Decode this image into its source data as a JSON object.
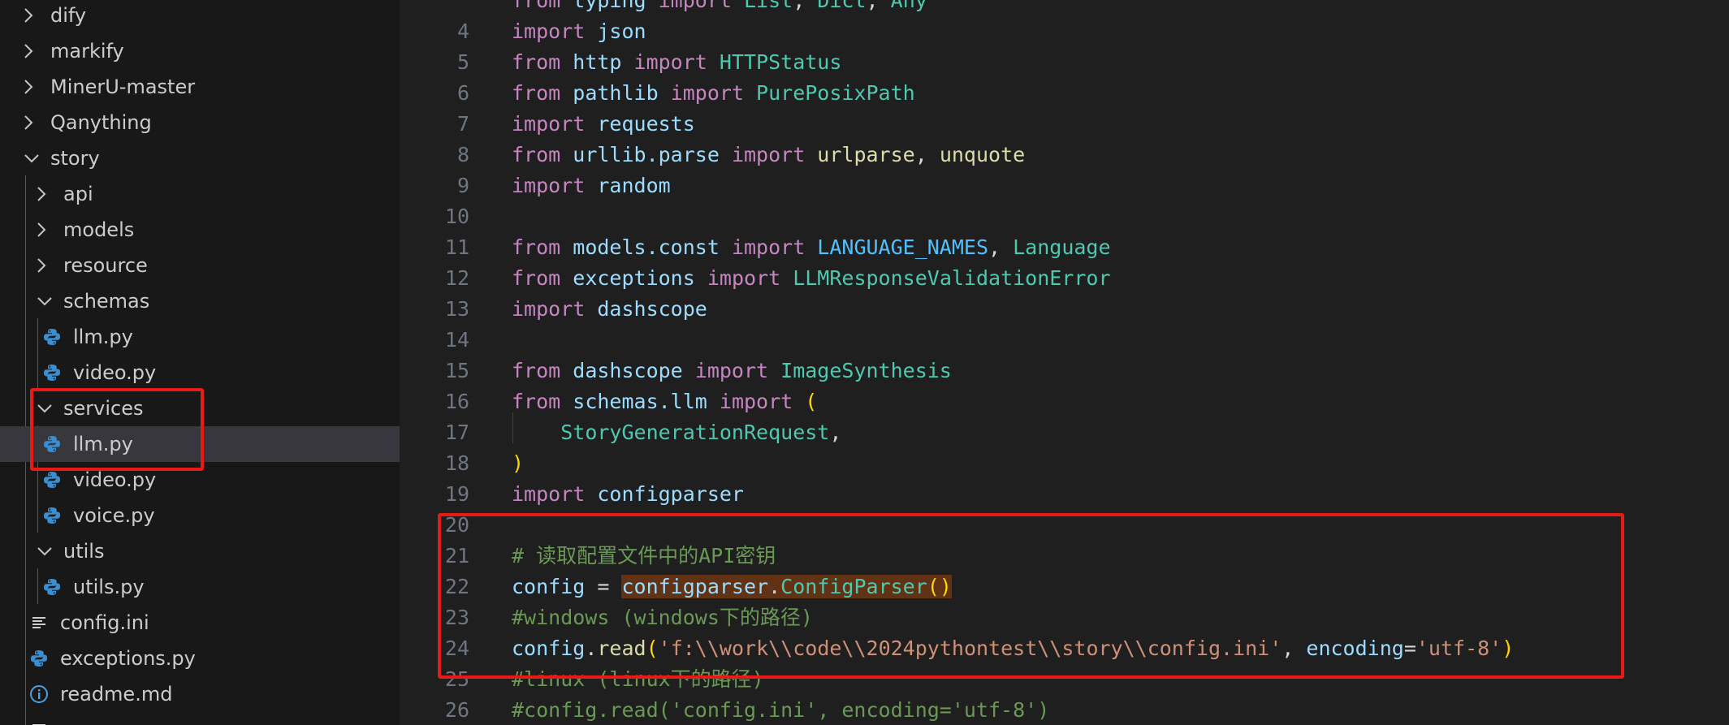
{
  "explorer": {
    "items": [
      {
        "label": "dify",
        "indent": 0,
        "kind": "folder",
        "open": false
      },
      {
        "label": "markify",
        "indent": 0,
        "kind": "folder",
        "open": false
      },
      {
        "label": "MinerU-master",
        "indent": 0,
        "kind": "folder",
        "open": false
      },
      {
        "label": "Qanything",
        "indent": 0,
        "kind": "folder",
        "open": false
      },
      {
        "label": "story",
        "indent": 0,
        "kind": "folder",
        "open": true
      },
      {
        "label": "api",
        "indent": 1,
        "kind": "folder",
        "open": false
      },
      {
        "label": "models",
        "indent": 1,
        "kind": "folder",
        "open": false
      },
      {
        "label": "resource",
        "indent": 1,
        "kind": "folder",
        "open": false
      },
      {
        "label": "schemas",
        "indent": 1,
        "kind": "folder",
        "open": true
      },
      {
        "label": "llm.py",
        "indent": 2,
        "kind": "python"
      },
      {
        "label": "video.py",
        "indent": 2,
        "kind": "python"
      },
      {
        "label": "services",
        "indent": 1,
        "kind": "folder",
        "open": true
      },
      {
        "label": "llm.py",
        "indent": 2,
        "kind": "python",
        "selected": true
      },
      {
        "label": "video.py",
        "indent": 2,
        "kind": "python"
      },
      {
        "label": "voice.py",
        "indent": 2,
        "kind": "python"
      },
      {
        "label": "utils",
        "indent": 1,
        "kind": "folder",
        "open": true
      },
      {
        "label": "utils.py",
        "indent": 2,
        "kind": "python"
      },
      {
        "label": "config.ini",
        "indent": 1,
        "kind": "ini"
      },
      {
        "label": "exceptions.py",
        "indent": 1,
        "kind": "python"
      },
      {
        "label": "readme.md",
        "indent": 1,
        "kind": "info"
      },
      {
        "label": "",
        "indent": 1,
        "kind": "ini"
      }
    ]
  },
  "editor": {
    "lines": [
      {
        "n": "",
        "tokens": [
          [
            "k",
            "from "
          ],
          [
            "d",
            "typing "
          ],
          [
            "k",
            "import "
          ],
          [
            "t",
            "List"
          ],
          [
            "p",
            ", "
          ],
          [
            "t",
            "Dict"
          ],
          [
            "p",
            ", "
          ],
          [
            "t",
            "Any"
          ]
        ]
      },
      {
        "n": "4",
        "tokens": [
          [
            "k",
            "import "
          ],
          [
            "d",
            "json"
          ]
        ]
      },
      {
        "n": "5",
        "tokens": [
          [
            "k",
            "from "
          ],
          [
            "d",
            "http "
          ],
          [
            "k",
            "import "
          ],
          [
            "t",
            "HTTPStatus"
          ]
        ]
      },
      {
        "n": "6",
        "tokens": [
          [
            "k",
            "from "
          ],
          [
            "d",
            "pathlib "
          ],
          [
            "k",
            "import "
          ],
          [
            "t",
            "PurePosixPath"
          ]
        ]
      },
      {
        "n": "7",
        "tokens": [
          [
            "k",
            "import "
          ],
          [
            "d",
            "requests"
          ]
        ]
      },
      {
        "n": "8",
        "tokens": [
          [
            "k",
            "from "
          ],
          [
            "d",
            "urllib.parse "
          ],
          [
            "k",
            "import "
          ],
          [
            "f",
            "urlparse"
          ],
          [
            "p",
            ", "
          ],
          [
            "f",
            "unquote"
          ]
        ]
      },
      {
        "n": "9",
        "tokens": [
          [
            "k",
            "import "
          ],
          [
            "d",
            "random"
          ]
        ]
      },
      {
        "n": "10",
        "tokens": []
      },
      {
        "n": "11",
        "tokens": [
          [
            "k",
            "from "
          ],
          [
            "d",
            "models.const "
          ],
          [
            "k",
            "import "
          ],
          [
            "v",
            "LANGUAGE_NAMES"
          ],
          [
            "p",
            ", "
          ],
          [
            "t",
            "Language"
          ]
        ]
      },
      {
        "n": "12",
        "tokens": [
          [
            "k",
            "from "
          ],
          [
            "d",
            "exceptions "
          ],
          [
            "k",
            "import "
          ],
          [
            "t",
            "LLMResponseValidationError"
          ]
        ]
      },
      {
        "n": "13",
        "tokens": [
          [
            "k",
            "import "
          ],
          [
            "d",
            "dashscope"
          ]
        ]
      },
      {
        "n": "14",
        "tokens": []
      },
      {
        "n": "15",
        "tokens": [
          [
            "k",
            "from "
          ],
          [
            "d",
            "dashscope "
          ],
          [
            "k",
            "import "
          ],
          [
            "t",
            "ImageSynthesis"
          ]
        ]
      },
      {
        "n": "16",
        "tokens": [
          [
            "k",
            "from "
          ],
          [
            "d",
            "schemas.llm "
          ],
          [
            "k",
            "import "
          ],
          [
            "y",
            "("
          ]
        ]
      },
      {
        "n": "17",
        "tokens": [
          [
            "p",
            "    "
          ],
          [
            "t",
            "StoryGenerationRequest"
          ],
          [
            "p",
            ","
          ]
        ]
      },
      {
        "n": "18",
        "tokens": [
          [
            "y",
            ")"
          ]
        ]
      },
      {
        "n": "19",
        "tokens": [
          [
            "k",
            "import "
          ],
          [
            "d",
            "configparser"
          ]
        ]
      },
      {
        "n": "20",
        "tokens": []
      },
      {
        "n": "21",
        "tokens": [
          [
            "c",
            "# 读取配置文件中的API密钥"
          ]
        ]
      },
      {
        "n": "22",
        "tokens": [
          [
            "d",
            "config "
          ],
          [
            "p",
            "= "
          ],
          [
            "dh",
            "configparser"
          ],
          [
            "ph",
            "."
          ],
          [
            "th",
            "ConfigParser"
          ],
          [
            "yh",
            "()"
          ]
        ]
      },
      {
        "n": "23",
        "tokens": [
          [
            "c",
            "#windows (windows下的路径)"
          ]
        ]
      },
      {
        "n": "24",
        "tokens": [
          [
            "d",
            "config"
          ],
          [
            "p",
            "."
          ],
          [
            "f",
            "read"
          ],
          [
            "y",
            "("
          ],
          [
            "s",
            "'f:\\\\work\\\\code\\\\2024pythontest\\\\story\\\\config.ini'"
          ],
          [
            "p",
            ", "
          ],
          [
            "d",
            "encoding"
          ],
          [
            "p",
            "="
          ],
          [
            "s",
            "'utf-8'"
          ],
          [
            "y",
            ")"
          ]
        ]
      },
      {
        "n": "25",
        "tokens": [
          [
            "c",
            "#linux (linux下的路径)"
          ]
        ]
      },
      {
        "n": "26",
        "tokens": [
          [
            "c",
            "#config.read('config.ini', encoding='utf-8')"
          ]
        ]
      }
    ]
  },
  "colors": {
    "annotation": "#e81a16",
    "sidebar_bg": "#181818",
    "editor_bg": "#1f1f1f",
    "selected_bg": "#37373d",
    "python_icon": "#3b8ecf",
    "highlight_bg": "#613214"
  }
}
